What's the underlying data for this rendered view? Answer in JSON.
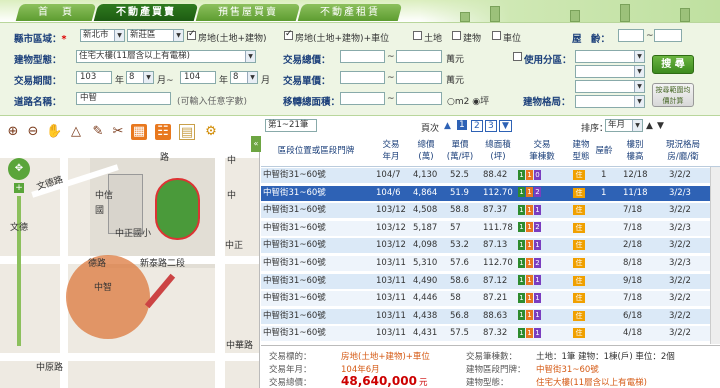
{
  "nav": {
    "tabs": [
      "首　頁",
      "不動產買賣",
      "預售屋買賣",
      "不動產租賃"
    ]
  },
  "search": {
    "county_label": "縣市區域：",
    "required_mark": "*",
    "county_value": "新北市",
    "district_value": "新莊區",
    "opt_land_building": "房地(土地+建物)",
    "opt_land_building_parking": "房地(土地+建物)+車位",
    "opt_land": "土地",
    "opt_building": "建物",
    "opt_parking": "車位",
    "age_label": "屋　齡：",
    "age_sep": "~",
    "type_label": "建物型態：",
    "type_value": "住宅大樓(11層含以上有電梯)",
    "total_price_label": "交易總價：",
    "unit_wan": "萬元",
    "use_zone_label": "使用分區：",
    "search_button": "搜 尋",
    "period_label": "交易期間：",
    "from_year": "103",
    "year_unit": "年",
    "from_month": "8",
    "month_unit": "月~",
    "to_year": "104",
    "to_month": "8",
    "month_unit2": "月",
    "unit_price_label": "交易單價：",
    "calc_button": "按尋範圍均價計算",
    "road_label": "道路名稱：",
    "road_value": "中智",
    "road_hint": "(可輸入任意字數)",
    "area_label": "移轉總面積：",
    "unit_m2": "m2",
    "unit_ping": "坪",
    "layout_label": "建物格局："
  },
  "map": {
    "labels": {
      "road1": "路",
      "road2": "文德路",
      "school": "中信",
      "school2": "國",
      "park": "中正國小",
      "road3": "德路",
      "road4": "新泰路二段",
      "road5": "中智",
      "road6": "中智",
      "road7": "中原路",
      "road8": "中正",
      "road9": "中",
      "road10": "中",
      "road11": "文德",
      "road12": "中華路"
    }
  },
  "list": {
    "range_label": "第1~21筆",
    "page_label": "頁次",
    "pages": [
      "1",
      "2",
      "3"
    ],
    "sort_label": "排序：",
    "sort_value": "年月",
    "headers": {
      "address": "區段位置或區段門牌",
      "date": "交易\n年月",
      "total": "總價\n(萬)",
      "unit": "單價\n(萬/坪)",
      "area": "總面積\n(坪)",
      "count": "交易\n筆棟數",
      "type": "建物\n型態",
      "floor": "屋齡",
      "level": "樓別\n樓高",
      "layout": "現況格局\n房/廳/衛"
    },
    "rows": [
      {
        "address": "中智街31~60號",
        "date": "104/7",
        "total": "4,130",
        "unit": "52.5",
        "area": "88.42",
        "b1": "1",
        "b2": "1",
        "b3": "0",
        "type": "住",
        "age": "1",
        "level": "12/18",
        "layout": "3/2/2"
      },
      {
        "address": "中智街31~60號",
        "date": "104/6",
        "total": "4,864",
        "unit": "51.9",
        "area": "112.70",
        "b1": "1",
        "b2": "1",
        "b3": "2",
        "type": "住",
        "age": "1",
        "level": "11/18",
        "layout": "3/2/3"
      },
      {
        "address": "中智街31~60號",
        "date": "103/12",
        "total": "4,508",
        "unit": "58.8",
        "area": "87.37",
        "b1": "1",
        "b2": "1",
        "b3": "1",
        "type": "住",
        "age": "",
        "level": "7/18",
        "layout": "3/2/2"
      },
      {
        "address": "中智街31~60號",
        "date": "103/12",
        "total": "5,187",
        "unit": "57",
        "area": "111.78",
        "b1": "1",
        "b2": "1",
        "b3": "2",
        "type": "住",
        "age": "",
        "level": "7/18",
        "layout": "3/2/3"
      },
      {
        "address": "中智街31~60號",
        "date": "103/12",
        "total": "4,098",
        "unit": "53.2",
        "area": "87.13",
        "b1": "1",
        "b2": "1",
        "b3": "1",
        "type": "住",
        "age": "",
        "level": "2/18",
        "layout": "3/2/2"
      },
      {
        "address": "中智街31~60號",
        "date": "103/11",
        "area": "112.70",
        "total": "5,310",
        "unit": "57.6",
        "b1": "1",
        "b2": "1",
        "b3": "2",
        "type": "住",
        "age": "",
        "level": "8/18",
        "layout": "3/2/3"
      },
      {
        "address": "中智街31~60號",
        "date": "103/11",
        "total": "4,490",
        "unit": "58.6",
        "area": "87.12",
        "b1": "1",
        "b2": "1",
        "b3": "1",
        "type": "住",
        "age": "",
        "level": "9/18",
        "layout": "3/2/2"
      },
      {
        "address": "中智街31~60號",
        "date": "103/11",
        "total": "4,446",
        "unit": "58",
        "area": "87.21",
        "b1": "1",
        "b2": "1",
        "b3": "1",
        "type": "住",
        "age": "",
        "level": "7/18",
        "layout": "3/2/2"
      },
      {
        "address": "中智街31~60號",
        "date": "103/11",
        "total": "4,438",
        "unit": "56.8",
        "area": "88.63",
        "b1": "1",
        "b2": "1",
        "b3": "1",
        "type": "住",
        "age": "",
        "level": "6/18",
        "layout": "3/2/2"
      },
      {
        "address": "中智街31~60號",
        "date": "103/11",
        "total": "4,431",
        "unit": "57.5",
        "area": "87.32",
        "b1": "1",
        "b2": "1",
        "b3": "1",
        "type": "住",
        "age": "",
        "level": "4/18",
        "layout": "3/2/2"
      }
    ]
  },
  "detail": {
    "target_label": "交易標的：",
    "target_value": "房地(土地+建物)+車位",
    "date_label": "交易年月：",
    "date_value": "104年6月",
    "total_label": "交易總價：",
    "total_value": "48,640,000",
    "total_unit": "元",
    "count_label": "交易筆棟數：",
    "count_value": "土地：1筆 建物：1棟(戶) 車位：2個",
    "location_label": "建物區段門牌：",
    "location_value": "中智街31~60號",
    "btype_label": "建物型態：",
    "btype_value": "住宅大樓(11層含以上有電梯)"
  },
  "colors": {
    "badge_green": "#2e8b2e",
    "badge_orange": "#e8781e",
    "badge_purple": "#7a3dbf",
    "badge_yellow": "#f0a000"
  }
}
